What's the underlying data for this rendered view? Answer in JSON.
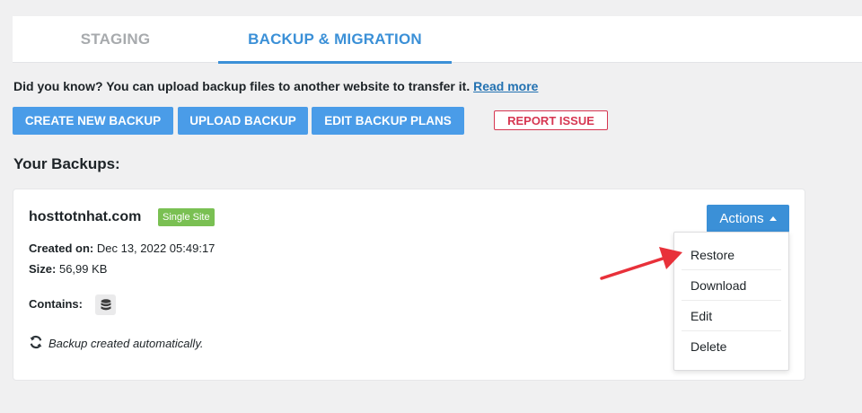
{
  "tabs": [
    {
      "label": "STAGING",
      "active": false
    },
    {
      "label": "BACKUP & MIGRATION",
      "active": true
    }
  ],
  "notice": {
    "text": "Did you know? You can upload backup files to another website to transfer it.",
    "link": "Read more"
  },
  "buttons": {
    "create": "CREATE NEW BACKUP",
    "upload": "UPLOAD BACKUP",
    "edit_plans": "EDIT BACKUP PLANS",
    "report": "REPORT ISSUE"
  },
  "section_title": "Your Backups:",
  "backup": {
    "site": "hosttotnhat.com",
    "badge": "Single Site",
    "created_label": "Created on:",
    "created_value": "Dec 13, 2022 05:49:17",
    "size_label": "Size:",
    "size_value": "56,99 KB",
    "contains_label": "Contains:",
    "contains_icon": "database-icon",
    "auto_note": "Backup created automatically."
  },
  "actions": {
    "label": "Actions",
    "items": [
      "Restore",
      "Download",
      "Edit",
      "Delete"
    ]
  },
  "colors": {
    "accent": "#3b90d7",
    "badge": "#7ac053",
    "report": "#d63651",
    "arrow": "#e8313a"
  }
}
